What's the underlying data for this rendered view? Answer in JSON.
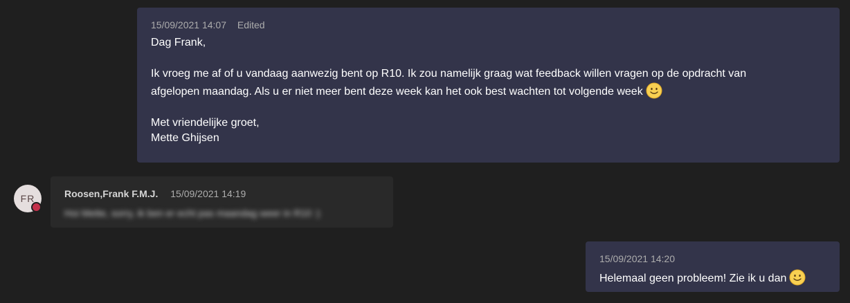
{
  "messages": [
    {
      "timestamp": "15/09/2021 14:07",
      "edited": "Edited",
      "lines": {
        "greeting": "Dag Frank,",
        "p1": "Ik vroeg me af of u vandaag aanwezig bent op R10. Ik zou namelijk graag wat feedback willen vragen op de opdracht van",
        "p2": "afgelopen maandag. Als u er niet meer bent deze week kan het ook best wachten tot volgende week",
        "closing": "Met vriendelijke groet,",
        "signature": "Mette Ghijsen"
      },
      "emoji": "smile-emoji"
    },
    {
      "author": "Roosen,Frank F.M.J.",
      "initials": "FR",
      "timestamp": "15/09/2021 14:19",
      "text": "Hoi Mette, sorry, ik ben er echt pas maandag weer in R10 :)",
      "presence_color": "#c4314b"
    },
    {
      "timestamp": "15/09/2021 14:20",
      "text": "Helemaal geen probleem! Zie ik u dan",
      "emoji": "smile-emoji"
    }
  ],
  "colors": {
    "background": "#1f1f1f",
    "sent_bubble": "#33344a",
    "received_bubble": "#292929",
    "meta_text": "#adadad"
  }
}
